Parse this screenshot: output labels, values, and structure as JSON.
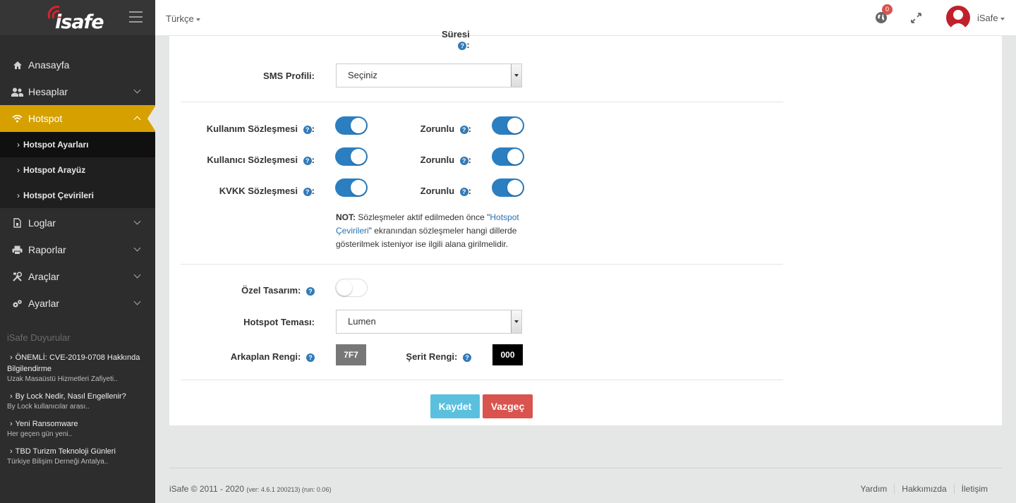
{
  "header": {
    "language": "Türkçe",
    "notification_count": "0",
    "username": "iSafe"
  },
  "sidebar": {
    "logo_text": "isafe",
    "items": [
      {
        "label": "Anasayfa",
        "icon": "home-icon"
      },
      {
        "label": "Hesaplar",
        "icon": "users-icon"
      },
      {
        "label": "Hotspot",
        "icon": "wifi-icon"
      },
      {
        "label": "Loglar",
        "icon": "log-file-icon"
      },
      {
        "label": "Raporlar",
        "icon": "printer-icon"
      },
      {
        "label": "Araçlar",
        "icon": "tools-icon"
      },
      {
        "label": "Ayarlar",
        "icon": "gears-icon"
      }
    ],
    "submenu": [
      "Hotspot Ayarları",
      "Hotspot Arayüz",
      "Hotspot Çevirileri"
    ],
    "announcements_title": "iSafe Duyurular",
    "announcements": [
      {
        "title": "ÖNEMLİ: CVE-2019-0708 Hakkında Bilgilendirme",
        "desc": "Uzak Masaüstü Hizmetleri Zafiyeti.."
      },
      {
        "title": "By Lock Nedir, Nasıl Engellenir?",
        "desc": "By Lock kullanıcılar arası.."
      },
      {
        "title": "Yeni Ransomware",
        "desc": "Her geçen gün yeni.."
      },
      {
        "title": "TBD Turizm Teknoloji Günleri",
        "desc": "Türkiye Bilişim Derneği Antalya.."
      }
    ]
  },
  "form": {
    "partial_label": "Süresi",
    "sms_profile_label": "SMS Profili:",
    "sms_profile_value": "Seçiniz",
    "usage_agreement_label": "Kullanım Sözleşmesi",
    "user_agreement_label": "Kullanıcı Sözleşmesi",
    "kvkk_label": "KVKK Sözleşmesi",
    "required_label": "Zorunlu",
    "note_prefix": "NOT:",
    "note_part1": " Sözleşmeler aktif edilmeden önce \"",
    "note_link": "Hotspot Çevirileri",
    "note_part2": "\" ekranından sözleşmeler hangi dillerde gösterilmek isteniyor ise ilgili alana girilmelidir.",
    "custom_design_label": "Özel Tasarım:",
    "theme_label": "Hotspot Teması:",
    "theme_value": "Lumen",
    "bg_color_label": "Arkaplan Rengi:",
    "bg_color_value": "7F7",
    "strip_color_label": "Şerit Rengi:",
    "strip_color_value": "000",
    "save_label": "Kaydet",
    "cancel_label": "Vazgeç"
  },
  "footer": {
    "copyright": "iSafe © 2011 - 2020",
    "version": "(ver: 4.6.1 200213) (run: 0.06)",
    "links": [
      "Yardım",
      "Hakkımızda",
      "İletişim"
    ]
  },
  "colors": {
    "accent": "#d6a100",
    "toggle_on": "#2b7fc1",
    "save": "#5bc0de",
    "cancel": "#d9534f"
  }
}
